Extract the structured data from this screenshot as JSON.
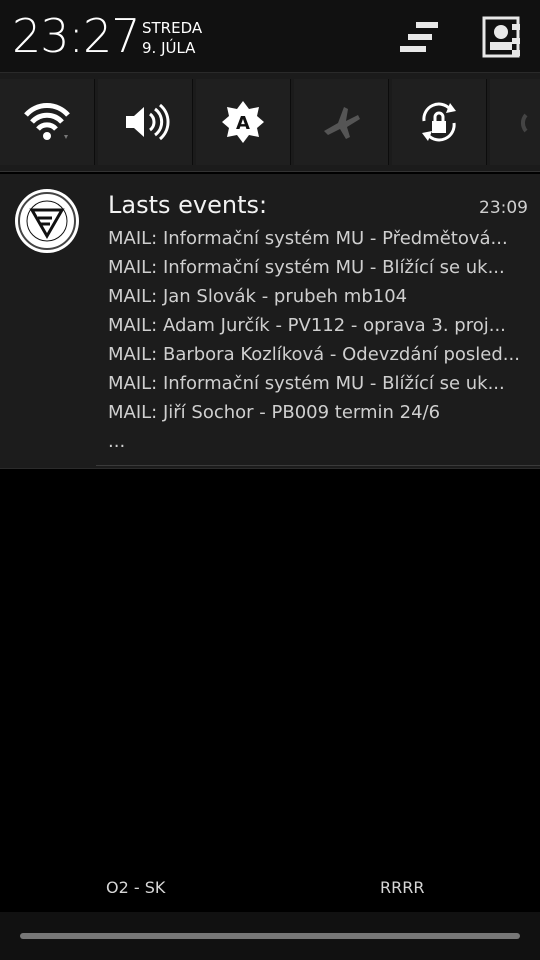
{
  "header": {
    "time": "23:27",
    "day": "STREDA",
    "date": "9. JÚLA",
    "settings_icon": "quick-settings-icon",
    "profile_icon": "user-profile-icon"
  },
  "quick_settings": [
    {
      "name": "wifi",
      "icon": "wifi-icon"
    },
    {
      "name": "sound",
      "icon": "volume-icon"
    },
    {
      "name": "auto-brightness",
      "icon": "brightness-auto-icon"
    },
    {
      "name": "airplane",
      "icon": "airplane-icon"
    },
    {
      "name": "rotation-lock",
      "icon": "rotation-lock-icon"
    }
  ],
  "notification": {
    "title": "Lasts events:",
    "time": "23:09",
    "lines": [
      "MAIL: Informační systém MU - Předmětová...",
      "MAIL: Informační systém MU - Blížící se uk...",
      "MAIL: Jan Slovák - prubeh mb104",
      "MAIL: Adam Jurčík - PV112 - oprava 3. proj...",
      "MAIL: Barbora Kozlíková - Odevzdání posled...",
      "MAIL: Informační systém MU - Blížící se uk...",
      "MAIL: Jiří Sochor - PB009 termin 24/6",
      "..."
    ]
  },
  "carriers": {
    "left": "O2 - SK",
    "right": "RRRR"
  },
  "colors": {
    "background": "#000000",
    "panel": "#1c1c1c",
    "text": "#ffffff",
    "muted": "#cfcfcf"
  }
}
